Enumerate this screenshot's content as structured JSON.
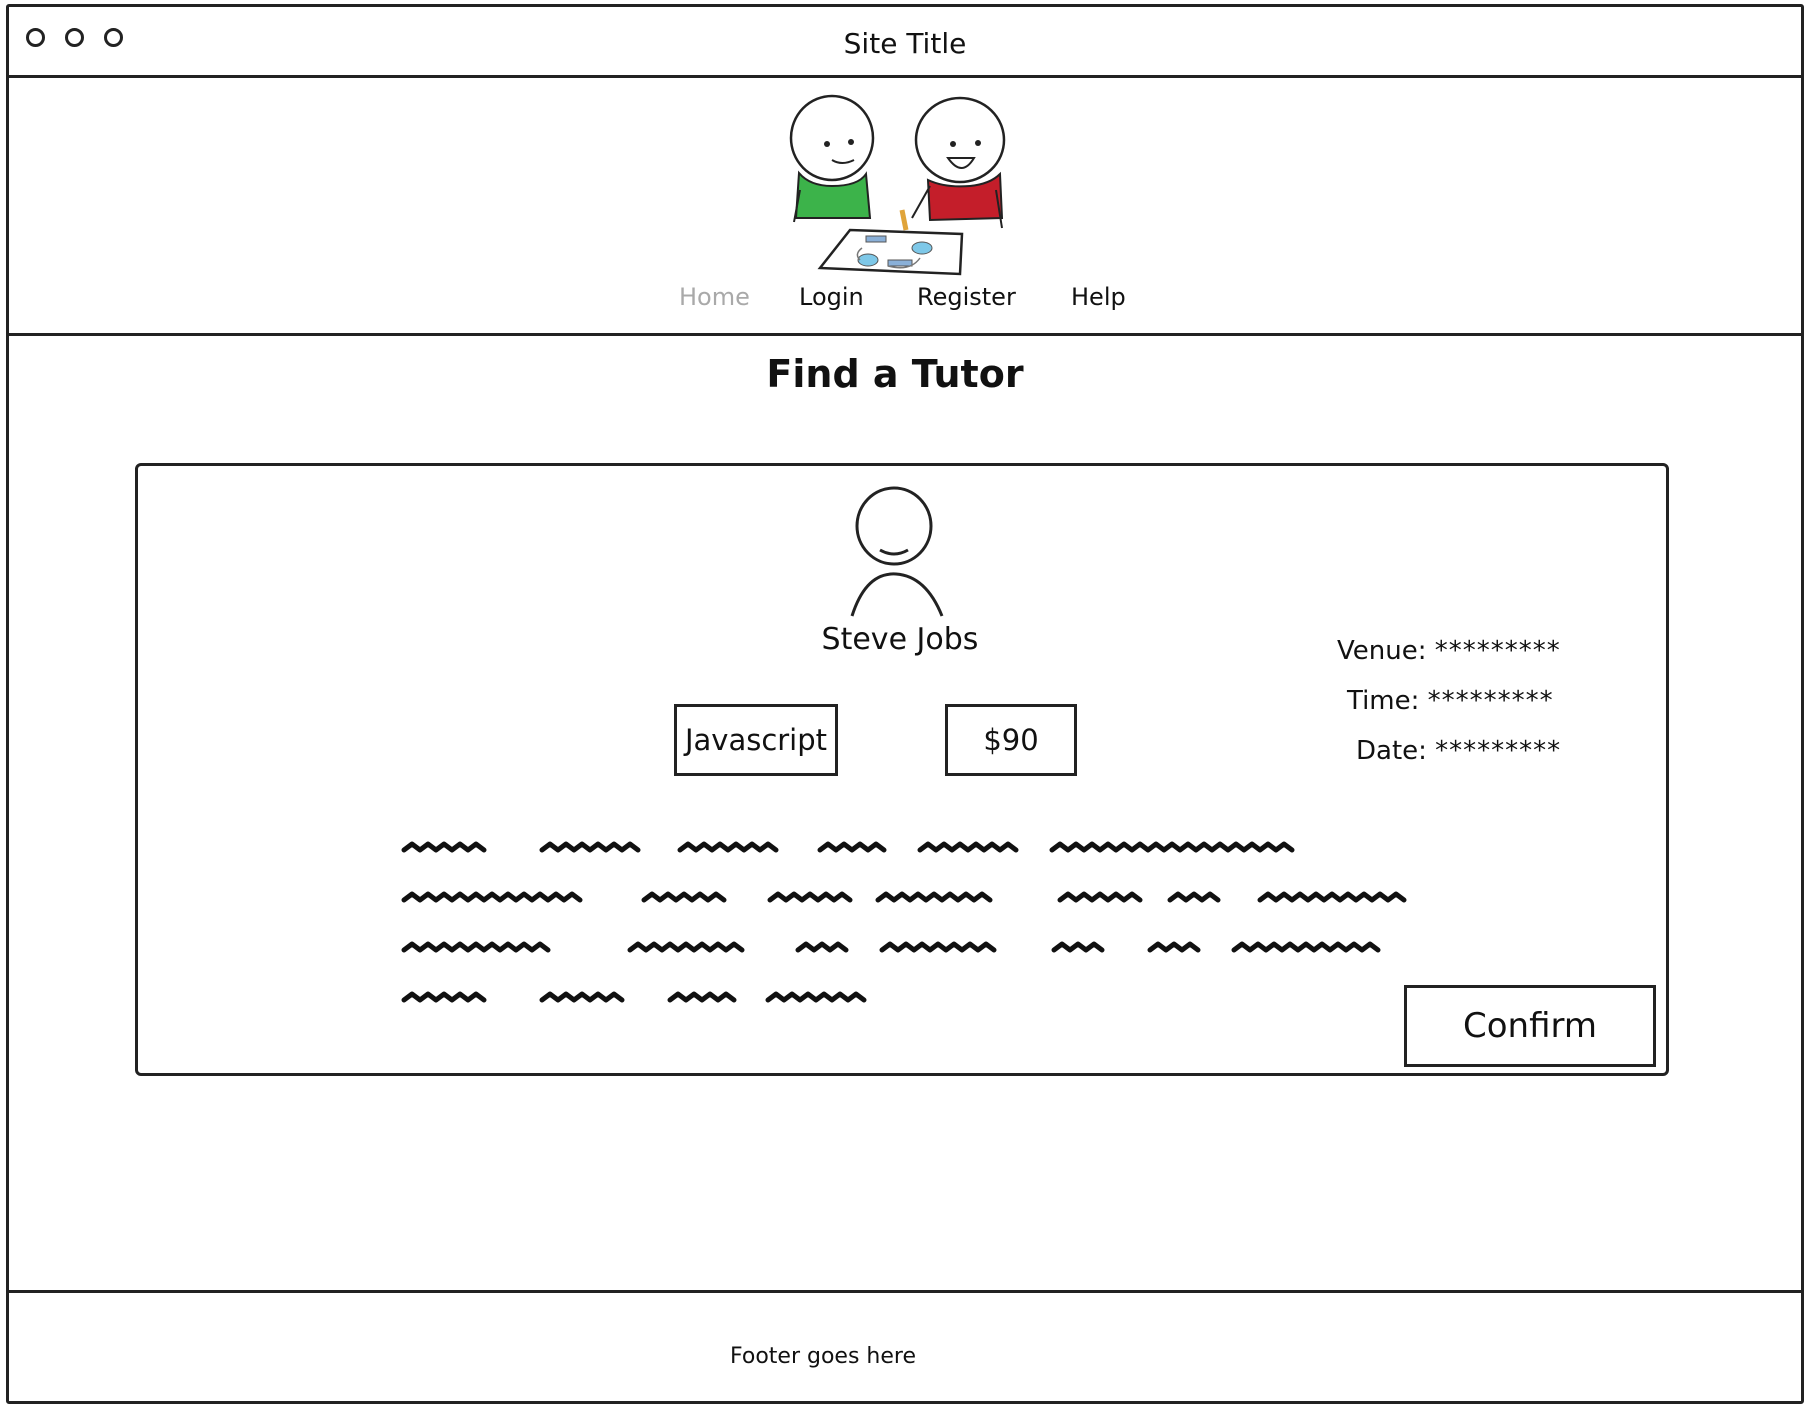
{
  "browser": {
    "site_title": "Site Title",
    "window_controls": [
      "circle-icon",
      "circle-icon",
      "circle-icon"
    ]
  },
  "header": {
    "hero_image": "two-students-illustration",
    "nav": [
      {
        "label": "Home",
        "active": true
      },
      {
        "label": "Login",
        "active": false
      },
      {
        "label": "Register",
        "active": false
      },
      {
        "label": "Help",
        "active": false
      }
    ]
  },
  "main": {
    "page_title": "Find a Tutor",
    "tutor_card": {
      "avatar_icon": "person-icon",
      "name": "Steve Jobs",
      "subject": "Javascript",
      "price": "$90",
      "details": [
        {
          "label": "Venue:",
          "value": "*********"
        },
        {
          "label": "Time:",
          "value": "*********"
        },
        {
          "label": "Date:",
          "value": "*********"
        }
      ],
      "confirm_label": "Confirm"
    }
  },
  "footer": {
    "text": "Footer goes here"
  },
  "colors": {
    "stroke": "#222222",
    "nav_active": "#a9a9a9",
    "green_shirt": "#3cb34a",
    "red_shirt": "#c41e2a",
    "diagram_blue": "#7ec8e8"
  }
}
